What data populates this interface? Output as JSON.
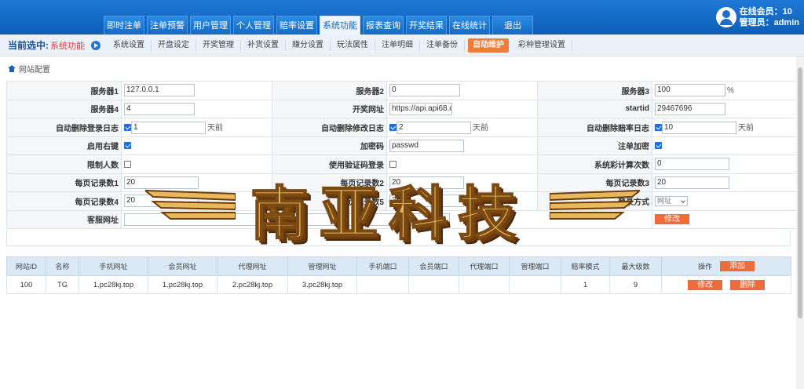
{
  "nav": [
    "即时注单",
    "注单预警",
    "用户管理",
    "个人管理",
    "赔率设置",
    "系统功能",
    "报表查询",
    "开奖结果",
    "在线统计",
    "退出"
  ],
  "nav_active": "系统功能",
  "user": {
    "online_label": "在线会员：10",
    "admin_label": "管理员：admin"
  },
  "subnav": {
    "current_label": "当前选中:",
    "current_value": "系统功能",
    "items": [
      "系统设置",
      "开盘设定",
      "开奖管理",
      "补货设置",
      "赚分设置",
      "玩法属性",
      "注单明细",
      "注单备份",
      "自动维护",
      "彩种管理设置"
    ],
    "active": "自动维护"
  },
  "breadcrumb": "网站配置",
  "config": {
    "server1_label": "服务器1",
    "server1_value": "127.0.0.1",
    "server2_label": "服务器2",
    "server2_value": "0",
    "server3_label": "服务器3",
    "server3_value": "100",
    "server3_unit": "%",
    "server4_label": "服务器4",
    "server4_value": "4",
    "lottery_url_label": "开奖网址",
    "lottery_url_value": "https://api.api68.cc",
    "startid_label": "startid",
    "startid_value": "29467696",
    "auto_del_login_label": "自动删除登录日志",
    "auto_del_login_value": "1",
    "auto_del_login_unit": "天前",
    "auto_del_modify_label": "自动删除修改日志",
    "auto_del_modify_value": "2",
    "auto_del_modify_unit": "天前",
    "auto_del_odds_label": "自动删除赔率日志",
    "auto_del_odds_value": "10",
    "auto_del_odds_unit": "天前",
    "right_click_label": "启用右键",
    "encrypt_code_label": "加密码",
    "encrypt_code_value": "passwd",
    "bet_encrypt_label": "注单加密",
    "limit_users_label": "限制人数",
    "verify_login_label": "使用验证码登录",
    "system_calc_label": "系统彩计算次数",
    "system_calc_value": "0",
    "per_page1_label": "每页记录数1",
    "per_page1_value": "20",
    "per_page2_label": "每页记录数2",
    "per_page2_value": "20",
    "per_page3_label": "每页记录数3",
    "per_page3_value": "20",
    "per_page4_label": "每页记录数4",
    "per_page4_value": "20",
    "per_page5_label": "每页记录数5",
    "per_page5_value": "20",
    "login_mode_label": "登录方式",
    "login_mode_value": "网址",
    "service_url_label": "客服网址",
    "service_url_value": "",
    "modify_button": "修改"
  },
  "site_table": {
    "columns": [
      "网站ID",
      "名称",
      "手机网址",
      "会员网址",
      "代理网址",
      "管理网址",
      "手机端口",
      "会员端口",
      "代理端口",
      "管理端口",
      "赔率模式",
      "最大级数",
      "操作"
    ],
    "add_button": "添加",
    "rows": [
      {
        "id": "100",
        "name": "TG",
        "mobile_url": "1.pc28kj.top",
        "member_url": "1.pc28kj.top",
        "agent_url": "2.pc28kj.top",
        "admin_url": "3.pc28kj.top",
        "mobile_port": "",
        "member_port": "",
        "agent_port": "",
        "admin_port": "",
        "odds_mode": "1",
        "max_level": "9",
        "edit": "修改",
        "delete": "删除"
      }
    ]
  },
  "watermark": "南亚科技"
}
